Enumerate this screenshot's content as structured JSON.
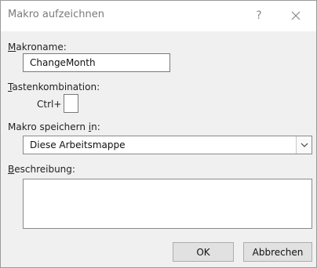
{
  "dialog": {
    "title": "Makro aufzeichnen",
    "help_glyph": "?"
  },
  "macro_name": {
    "label_accel": "M",
    "label_rest": "akroname:",
    "value": "ChangeMonth"
  },
  "shortcut": {
    "label_accel": "T",
    "label_rest": "astenkombination:",
    "prefix": "Ctrl+",
    "value": ""
  },
  "store_in": {
    "label_pre": "Makro speichern ",
    "label_accel": "i",
    "label_post": "n:",
    "selected": "Diese Arbeitsmappe"
  },
  "description": {
    "label_accel": "B",
    "label_rest": "eschreibung:",
    "value": ""
  },
  "buttons": {
    "ok": "OK",
    "cancel": "Abbrechen"
  }
}
